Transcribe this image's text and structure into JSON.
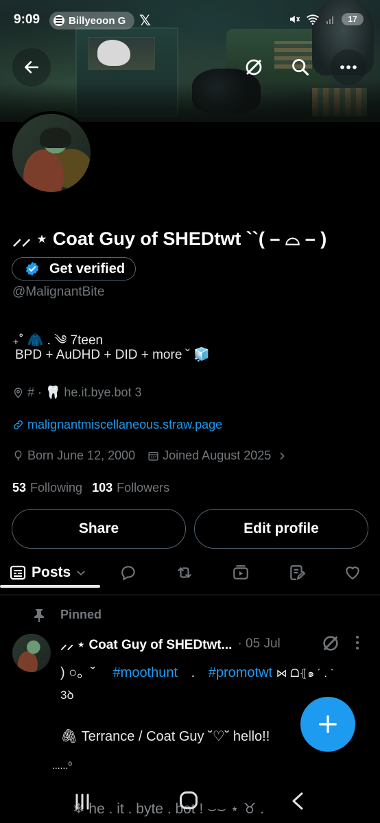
{
  "status_bar": {
    "time": "9:09",
    "media_text": "Billyeoon G",
    "app_icon": "x-logo",
    "network": "5",
    "battery": "17"
  },
  "top_actions": {
    "back_icon": "arrow-left-icon",
    "grok_icon": "grok-icon",
    "search_icon": "search-icon",
    "more_icon": "more-icon"
  },
  "profile": {
    "display_name": "⸝⸝ ⋆ Coat Guy of SHEDtwt ``( – ⌓ – )",
    "verify_label": "Get verified",
    "handle": "@MalignantBite",
    "bio_line1": "₊˚ 🧥 . ༄ 7teen",
    "bio_line2": "BPD + AuDHD + DID + more ˘ 🧊",
    "location": "# · 🦷 he.it.bye.bot 3",
    "website": "malignantmiscellaneous.straw.page",
    "born": "Born June 12, 2000",
    "joined": "Joined August 2025",
    "following_count": "53",
    "following_label": "Following",
    "followers_count": "103",
    "followers_label": "Followers",
    "share_label": "Share",
    "edit_label": "Edit profile"
  },
  "tabs": {
    "posts_label": "Posts",
    "icons": [
      "replies-icon",
      "reposts-icon",
      "media-icon",
      "articles-icon",
      "likes-icon"
    ]
  },
  "pinned_post": {
    "pinned_label": "Pinned",
    "author": "⸝⸝ ⋆ Coat Guy of SHEDtwt...",
    "date": "· 05 Jul",
    "line1_pre": ")  ○。˘",
    "hashtag1": "#moothunt",
    "line1_mid": " . ",
    "hashtag2": "#promotwt",
    "line1_post": " ⋈ ᗝ⦃๑ ´ . `",
    "line2": "3ꝺ",
    "line3": "🖇  Terrance / Coat Guy  ˘♡˘ hello!!",
    "line4": "......⁰"
  },
  "fab": {
    "icon": "plus-icon"
  },
  "nav_bar": {
    "background_text": "❄ he . it . byte . bot   !          ⌣⌣ ⋆ ♉ ."
  },
  "colors": {
    "accent": "#1d9bf0",
    "muted": "#71767b",
    "border": "#536471",
    "text": "#e7e9ea"
  }
}
